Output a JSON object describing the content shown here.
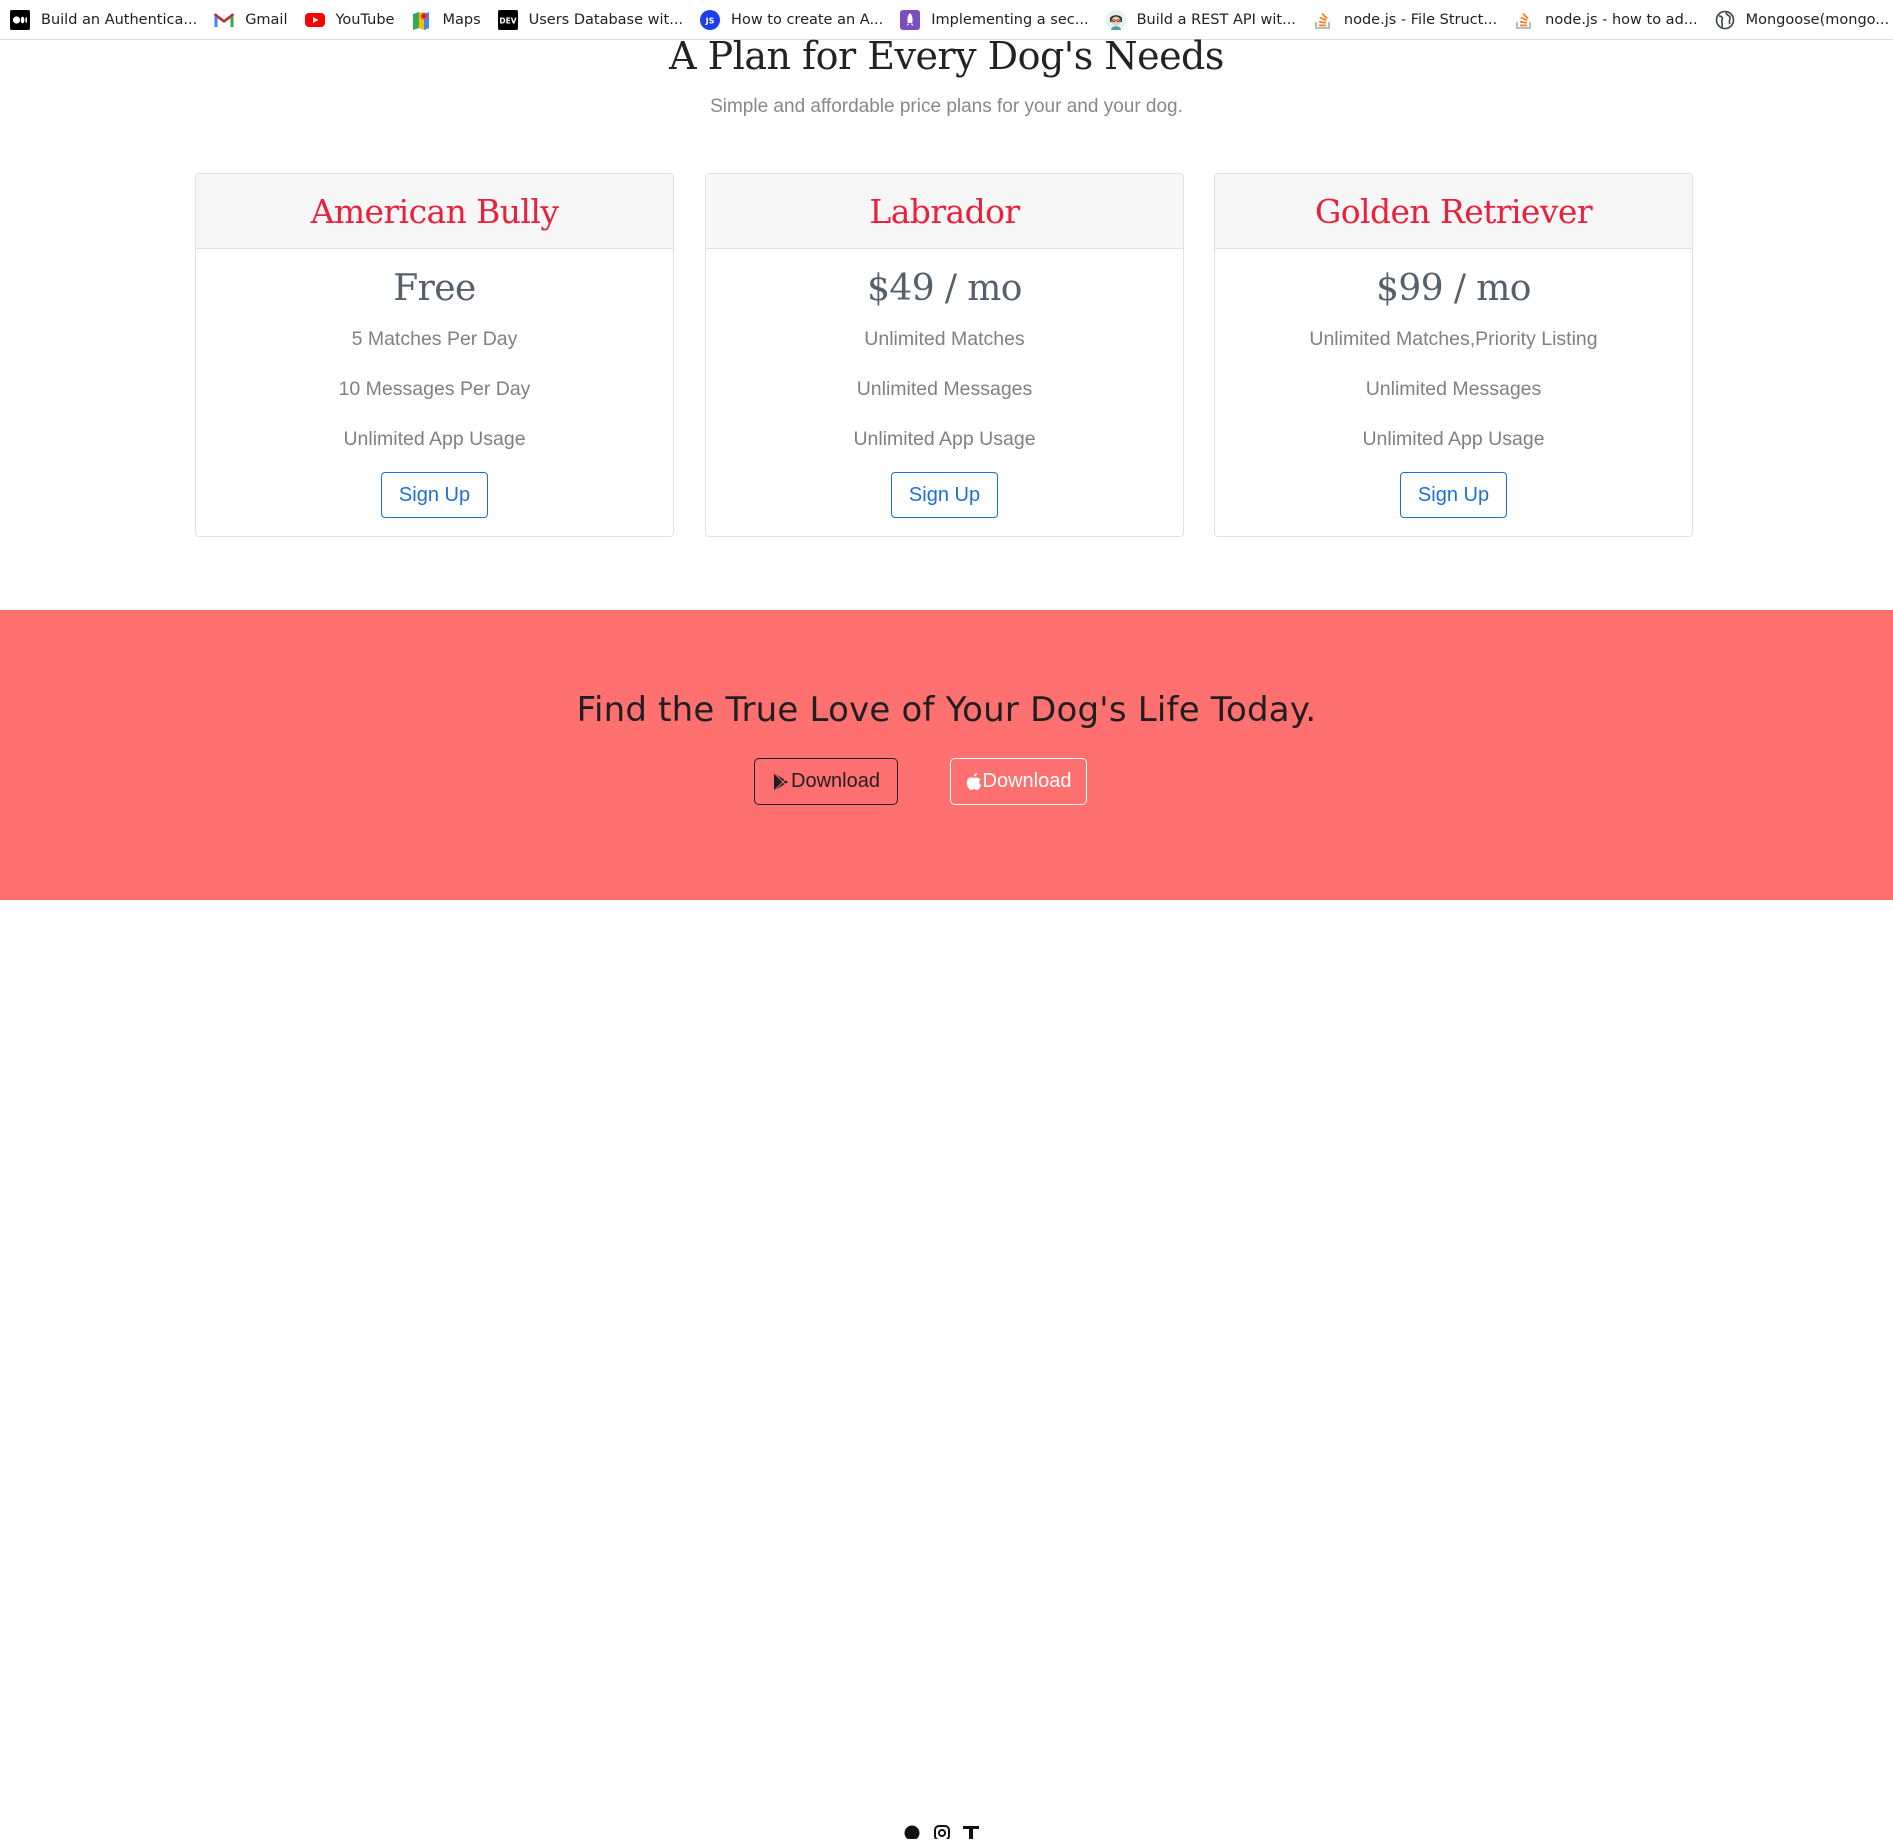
{
  "bookmarks": [
    {
      "label": "Build an Authentica...",
      "icon": "medium-icon"
    },
    {
      "label": "Gmail",
      "icon": "gmail-icon"
    },
    {
      "label": "YouTube",
      "icon": "youtube-icon"
    },
    {
      "label": "Maps",
      "icon": "maps-icon"
    },
    {
      "label": "Users Database wit...",
      "icon": "dev-icon"
    },
    {
      "label": "How to create an A...",
      "icon": "js-icon"
    },
    {
      "label": "Implementing a sec...",
      "icon": "rocket-icon"
    },
    {
      "label": "Build a REST API wit...",
      "icon": "avatar-icon"
    },
    {
      "label": "node.js - File Struct...",
      "icon": "stackoverflow-icon"
    },
    {
      "label": "node.js - how to ad...",
      "icon": "stackoverflow-icon"
    },
    {
      "label": "Mongoose(mongo...",
      "icon": "globe-icon"
    }
  ],
  "pricing": {
    "title": "A Plan for Every Dog's Needs",
    "subtitle": "Simple and affordable price plans for your and your dog.",
    "plans": [
      {
        "name": "American Bully",
        "price": "Free",
        "features": [
          "5 Matches Per Day",
          "10 Messages Per Day",
          "Unlimited App Usage"
        ],
        "button": "Sign Up"
      },
      {
        "name": "Labrador",
        "price": "$49 / mo",
        "features": [
          "Unlimited Matches",
          "Unlimited Messages",
          "Unlimited App Usage"
        ],
        "button": "Sign Up"
      },
      {
        "name": "Golden Retriever",
        "price": "$99 / mo",
        "features": [
          "Unlimited Matches,Priority Listing",
          "Unlimited Messages",
          "Unlimited App Usage"
        ],
        "button": "Sign Up"
      }
    ]
  },
  "cta": {
    "title": "Find the True Love of Your Dog's Life Today.",
    "google_play_label": "Download",
    "apple_label": "Download"
  },
  "colors": {
    "accent_red": "#e8213c",
    "cta_background": "#ff7070",
    "button_blue": "#1e6fd9"
  }
}
